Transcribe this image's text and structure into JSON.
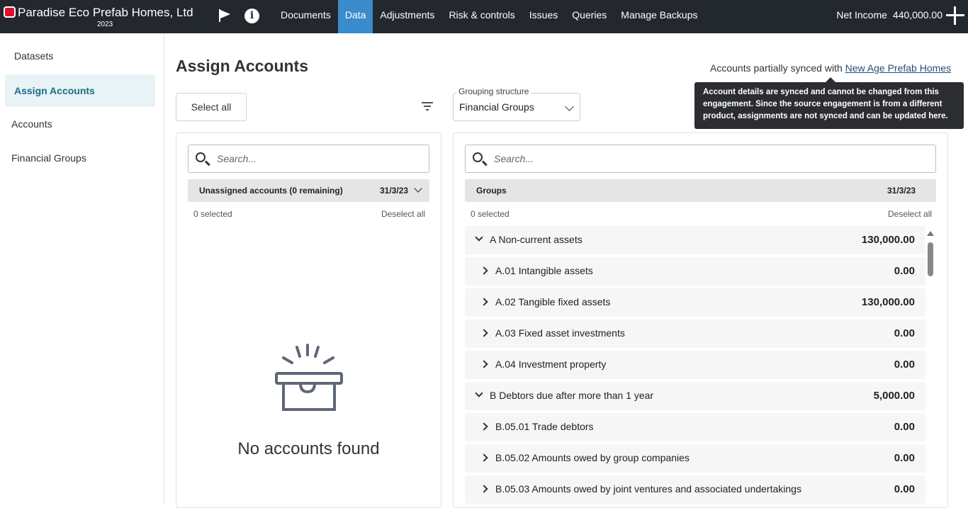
{
  "app": {
    "title": "Paradise Eco Prefab Homes, Ltd",
    "year": "2023"
  },
  "nav": {
    "items": [
      {
        "label": "Documents"
      },
      {
        "label": "Data"
      },
      {
        "label": "Adjustments"
      },
      {
        "label": "Risk & controls"
      },
      {
        "label": "Issues"
      },
      {
        "label": "Queries"
      },
      {
        "label": "Manage Backups"
      }
    ],
    "active": "Data"
  },
  "header": {
    "net_income_label": "Net Income",
    "net_income_value": "440,000.00"
  },
  "sidebar": {
    "items": [
      {
        "label": "Datasets"
      },
      {
        "label": "Assign Accounts"
      },
      {
        "label": "Accounts"
      },
      {
        "label": "Financial Groups"
      }
    ]
  },
  "page": {
    "title": "Assign Accounts",
    "sync_text": "Accounts partially synced with",
    "sync_link": "New Age Prefab Homes",
    "tooltip": "Account details are synced and cannot be changed from this engagement. Since the source engagement is from a different product, assignments are not synced and can be updated here.",
    "select_all": "Select all",
    "grouping_label": "Grouping structure",
    "grouping_value": "Financial Groups"
  },
  "left_panel": {
    "search_placeholder": "Search...",
    "header_label": "Unassigned accounts (0 remaining)",
    "header_date": "31/3/23",
    "selected": "0 selected",
    "deselect": "Deselect all",
    "empty_text": "No accounts found"
  },
  "right_panel": {
    "search_placeholder": "Search...",
    "header_label": "Groups",
    "header_date": "31/3/23",
    "selected": "0 selected",
    "deselect": "Deselect all",
    "rows": [
      {
        "label": "A Non-current assets",
        "value": "130,000.00",
        "level": 0,
        "expanded": true
      },
      {
        "label": "A.01 Intangible assets",
        "value": "0.00",
        "level": 1,
        "expanded": false
      },
      {
        "label": "A.02 Tangible fixed assets",
        "value": "130,000.00",
        "level": 1,
        "expanded": false
      },
      {
        "label": "A.03 Fixed asset investments",
        "value": "0.00",
        "level": 1,
        "expanded": false
      },
      {
        "label": "A.04 Investment property",
        "value": "0.00",
        "level": 1,
        "expanded": false
      },
      {
        "label": "B Debtors due after more than 1 year",
        "value": "5,000.00",
        "level": 0,
        "expanded": true
      },
      {
        "label": "B.05.01 Trade debtors",
        "value": "0.00",
        "level": 1,
        "expanded": false
      },
      {
        "label": "B.05.02 Amounts owed by group companies",
        "value": "0.00",
        "level": 1,
        "expanded": false
      },
      {
        "label": "B.05.03 Amounts owed by joint ventures and associated undertakings",
        "value": "0.00",
        "level": 1,
        "expanded": false
      }
    ]
  }
}
